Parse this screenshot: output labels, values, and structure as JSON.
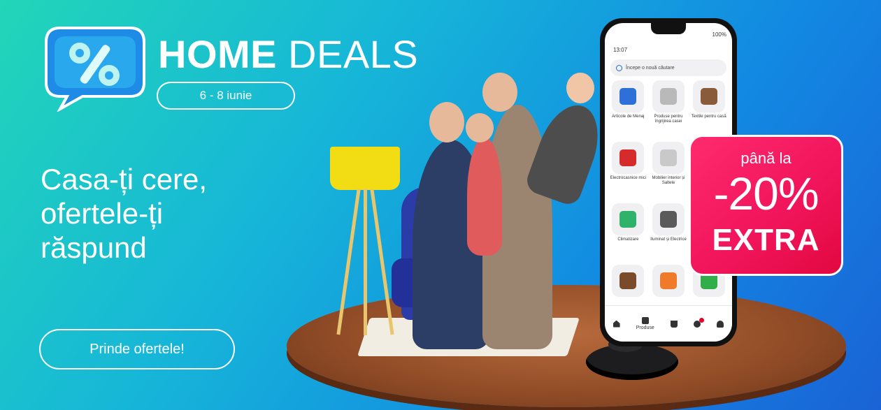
{
  "brand": {
    "title_bold": "HOME",
    "title_light": " DEALS",
    "dates": "6 - 8 iunie"
  },
  "headline": {
    "line1": "Casa-ți cere,",
    "line2": "ofertele-ți",
    "line3": "răspund"
  },
  "cta": {
    "label": "Prinde ofertele!"
  },
  "promo": {
    "prefix": "până la",
    "discount": "-20%",
    "suffix": "EXTRA"
  },
  "phone": {
    "time": "13:07",
    "battery": "100%",
    "search_placeholder": "Începe o nouă căutare",
    "categories": [
      {
        "label": "Articole de Menaj",
        "color": "#2e6fd8"
      },
      {
        "label": "Produse pentru îngrijirea casei",
        "color": "#b9b9b9"
      },
      {
        "label": "Textile pentru casă",
        "color": "#8a5b3a"
      },
      {
        "label": "Electrocasnice mici",
        "color": "#d62b2b"
      },
      {
        "label": "Mobilier interior și Saltele",
        "color": "#c9c9c9"
      },
      {
        "label": "",
        "color": "#e4e4e4"
      },
      {
        "label": "Climatizare",
        "color": "#2fb36b"
      },
      {
        "label": "Iluminat și Electrice",
        "color": "#5a5a5a"
      },
      {
        "label": "",
        "color": "#e4e4e4"
      },
      {
        "label": "",
        "color": "#7a4b2a"
      },
      {
        "label": "",
        "color": "#ef7b2a"
      },
      {
        "label": "",
        "color": "#2fae4a"
      }
    ],
    "tabbar": {
      "home": "",
      "products": "Produse",
      "cart": "",
      "favorites": "",
      "account": ""
    }
  },
  "colors": {
    "bg_start": "#22d6b8",
    "bg_end": "#1a63d6",
    "promo": "#f0145a"
  }
}
